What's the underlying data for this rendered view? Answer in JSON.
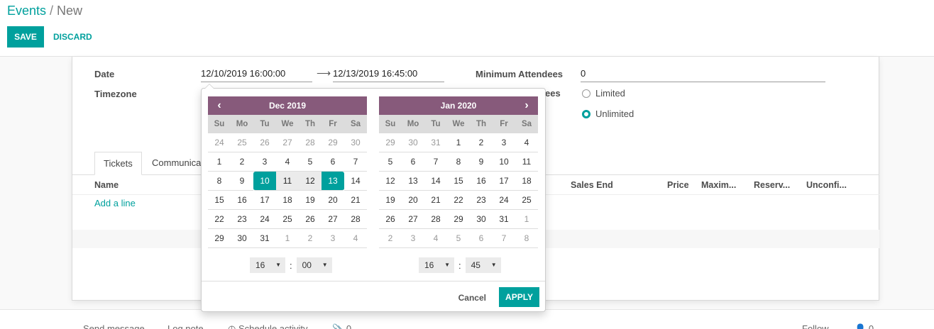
{
  "breadcrumb": {
    "parent": "Events",
    "separator": "/",
    "current": "New"
  },
  "toolbar": {
    "save_label": "SAVE",
    "discard_label": "DISCARD"
  },
  "form": {
    "date_label": "Date",
    "date_start": "12/10/2019 16:00:00",
    "date_end": "12/13/2019 16:45:00",
    "timezone_label": "Timezone",
    "min_attendees_label": "Minimum Attendees",
    "min_attendees_value": "0",
    "max_attendees_label_partial": "ees",
    "radio_limited": "Limited",
    "radio_unlimited": "Unlimited",
    "selected_radio": "Unlimited"
  },
  "tabs": [
    {
      "label": "Tickets"
    },
    {
      "label": "Communica"
    }
  ],
  "tickets_table": {
    "columns": [
      "Name",
      "Sales End",
      "Price",
      "Maxim...",
      "Reserv...",
      "Unconfi..."
    ],
    "add_line": "Add a line"
  },
  "picker": {
    "weekdays": [
      "Su",
      "Mo",
      "Tu",
      "We",
      "Th",
      "Fr",
      "Sa"
    ],
    "left": {
      "month": "Dec 2019",
      "weeks": [
        [
          "24",
          "25",
          "26",
          "27",
          "28",
          "29",
          "30"
        ],
        [
          "1",
          "2",
          "3",
          "4",
          "5",
          "6",
          "7"
        ],
        [
          "8",
          "9",
          "10",
          "11",
          "12",
          "13",
          "14"
        ],
        [
          "15",
          "16",
          "17",
          "18",
          "19",
          "20",
          "21"
        ],
        [
          "22",
          "23",
          "24",
          "25",
          "26",
          "27",
          "28"
        ],
        [
          "29",
          "30",
          "31",
          "1",
          "2",
          "3",
          "4"
        ]
      ],
      "hour": "16",
      "minute": "00"
    },
    "right": {
      "month": "Jan 2020",
      "weeks": [
        [
          "29",
          "30",
          "31",
          "1",
          "2",
          "3",
          "4"
        ],
        [
          "5",
          "6",
          "7",
          "8",
          "9",
          "10",
          "11"
        ],
        [
          "12",
          "13",
          "14",
          "15",
          "16",
          "17",
          "18"
        ],
        [
          "19",
          "20",
          "21",
          "22",
          "23",
          "24",
          "25"
        ],
        [
          "26",
          "27",
          "28",
          "29",
          "30",
          "31",
          "1"
        ],
        [
          "2",
          "3",
          "4",
          "5",
          "6",
          "7",
          "8"
        ]
      ],
      "hour": "16",
      "minute": "45"
    },
    "range_start": "10",
    "range_end": "13",
    "cancel_label": "Cancel",
    "apply_label": "APPLY",
    "prev_icon": "‹",
    "next_icon": "›"
  },
  "chatter": {
    "send_message": "Send message",
    "log_note": "Log note",
    "schedule_activity": "Schedule activity",
    "attachments": "0",
    "follow": "Follow",
    "followers": "0"
  },
  "colors": {
    "accent": "#00A09D",
    "calendar_header": "#875A7B"
  }
}
